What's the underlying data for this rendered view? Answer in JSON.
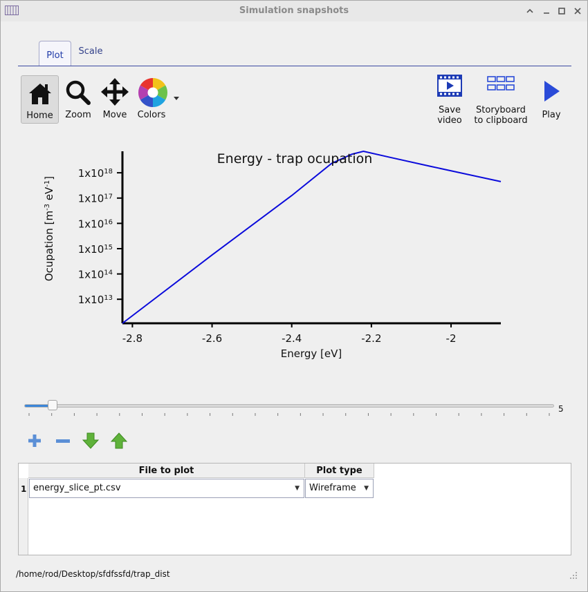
{
  "window": {
    "title": "Simulation snapshots"
  },
  "tabs": [
    {
      "label": "Plot"
    },
    {
      "label": "Scale"
    }
  ],
  "toolbar": {
    "home": "Home",
    "zoom": "Zoom",
    "move": "Move",
    "colors": "Colors",
    "save_video_1": "Save",
    "save_video_2": "video",
    "storyboard_1": "Storyboard",
    "storyboard_2": "to clipboard",
    "play": "Play"
  },
  "chart_data": {
    "type": "line",
    "title": "Energy - trap ocupation",
    "xlabel": "Energy [eV]",
    "ylabel_main": "Ocupation [m",
    "ylabel_sup1": "-3",
    "ylabel_mid": " eV",
    "ylabel_sup2": "-1",
    "ylabel_end": "]",
    "xlim": [
      -2.825,
      -1.875
    ],
    "ylim_log10": [
      12.05,
      18.85
    ],
    "yscale": "log",
    "grid": false,
    "x_ticks": [
      {
        "value": -2.8,
        "label": "-2.8"
      },
      {
        "value": -2.6,
        "label": "-2.6"
      },
      {
        "value": -2.4,
        "label": "-2.4"
      },
      {
        "value": -2.2,
        "label": "-2.2"
      },
      {
        "value": -2.0,
        "label": "-2"
      }
    ],
    "y_ticks": [
      {
        "exp": 13,
        "base": "1x10",
        "sup": "13"
      },
      {
        "exp": 14,
        "base": "1x10",
        "sup": "14"
      },
      {
        "exp": 15,
        "base": "1x10",
        "sup": "15"
      },
      {
        "exp": 16,
        "base": "1x10",
        "sup": "16"
      },
      {
        "exp": 17,
        "base": "1x10",
        "sup": "17"
      },
      {
        "exp": 18,
        "base": "1x10",
        "sup": "18"
      }
    ],
    "series": [
      {
        "color": "#0a0adb",
        "x": [
          -2.825,
          -2.6,
          -2.4,
          -2.3,
          -2.25,
          -2.22,
          -2.15,
          -2.05,
          -1.875
        ],
        "y_log10": [
          12.05,
          14.75,
          17.1,
          18.37,
          18.73,
          18.85,
          18.6,
          18.25,
          17.65
        ]
      }
    ]
  },
  "slider": {
    "value": "5",
    "fraction": 0.053
  },
  "table": {
    "headers": [
      "File to plot",
      "Plot type"
    ],
    "rows": [
      {
        "num": "1",
        "file": "energy_slice_pt.csv",
        "plot_type": "Wireframe"
      }
    ]
  },
  "status": {
    "path": "/home/rod/Desktop/sfdfssfd/trap_dist"
  },
  "colors": {
    "accent": "#1f3aa8",
    "line": "#0a0adb",
    "play": "#2a4bd8"
  }
}
